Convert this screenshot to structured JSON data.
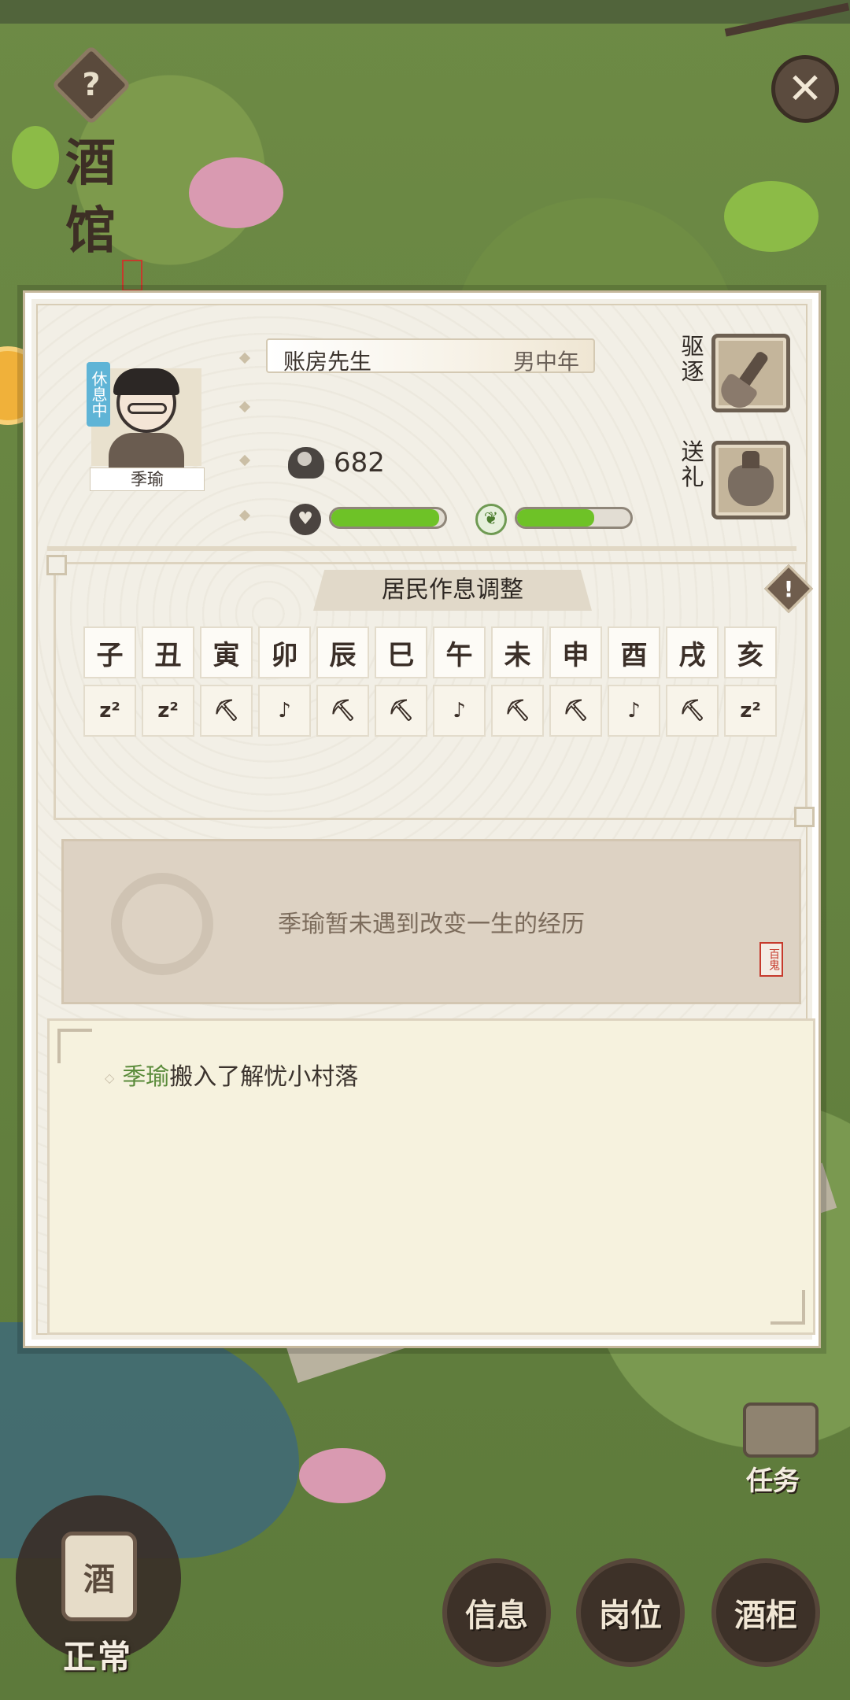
{
  "location_title": "酒馆",
  "resident": {
    "name": "季瑜",
    "status_badge": "休息中",
    "occupation": "账房先生",
    "gender_age": "男中年",
    "money": "682",
    "mood_fill": 0.95,
    "energy_fill": 0.68
  },
  "actions": {
    "expel_label": "驱逐",
    "gift_label": "送礼"
  },
  "schedule": {
    "title": "居民作息调整",
    "hours": [
      "子",
      "丑",
      "寅",
      "卯",
      "辰",
      "巳",
      "午",
      "未",
      "申",
      "酉",
      "戌",
      "亥"
    ],
    "activities": [
      "sleep",
      "sleep",
      "work",
      "leisure",
      "work",
      "work",
      "leisure",
      "work",
      "work",
      "leisure",
      "work",
      "sleep"
    ],
    "activity_icons": {
      "sleep": "zzz-icon",
      "work": "pickaxe-icon",
      "leisure": "leisure-icon"
    }
  },
  "story": {
    "text": "季瑜暂未遇到改变一生的经历",
    "seal": "百鬼"
  },
  "log": {
    "entries": [
      {
        "name": "季瑜",
        "text": "搬入了解忧小村落"
      }
    ]
  },
  "bottom": {
    "status_label": "正常",
    "jar_char": "酒",
    "info_label": "信息",
    "post_label": "岗位",
    "cabinet_label": "酒柜",
    "task_label": "任务"
  },
  "colors": {
    "accent_green": "#6ec227",
    "name_green": "#5a8b3a",
    "seal_red": "#c63a2c"
  }
}
